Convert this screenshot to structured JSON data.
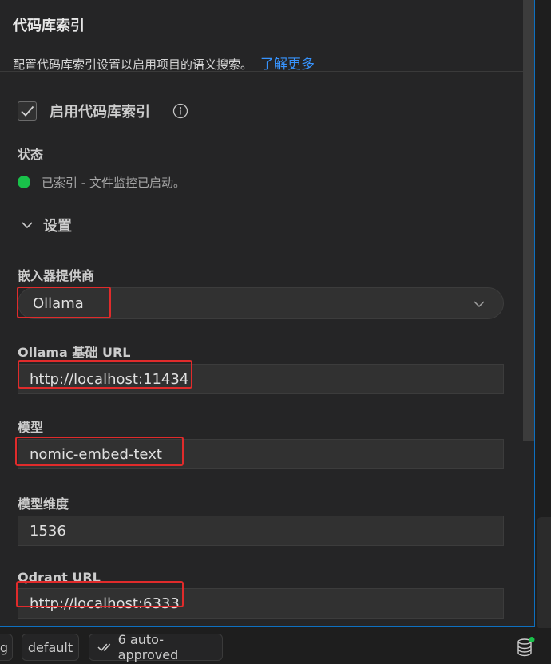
{
  "header": {
    "title": "代码库索引",
    "description": "配置代码库索引设置以启用项目的语义搜索。",
    "learn_more": "了解更多"
  },
  "enable": {
    "label": "启用代码库索引",
    "checked": true
  },
  "status": {
    "label": "状态",
    "text": "已索引 - 文件监控已启动。",
    "color": "#19c24a"
  },
  "settings": {
    "label": "设置",
    "expanded": true
  },
  "fields": {
    "provider": {
      "label": "嵌入器提供商",
      "value": "Ollama"
    },
    "base_url": {
      "label": "Ollama 基础 URL",
      "value": "http://localhost:11434"
    },
    "model": {
      "label": "模型",
      "value": "nomic-embed-text"
    },
    "dimension": {
      "label": "模型维度",
      "value": "1536"
    },
    "qdrant_url": {
      "label": "Qdrant URL",
      "value": "http://localhost:6333"
    }
  },
  "bottom_bar": {
    "left_fragment": "g",
    "mode": "default",
    "auto_approved": "6 auto-approved"
  },
  "colors": {
    "accent": "#3794ff",
    "highlight": "#e02b2b",
    "status_ok": "#19c24a"
  }
}
